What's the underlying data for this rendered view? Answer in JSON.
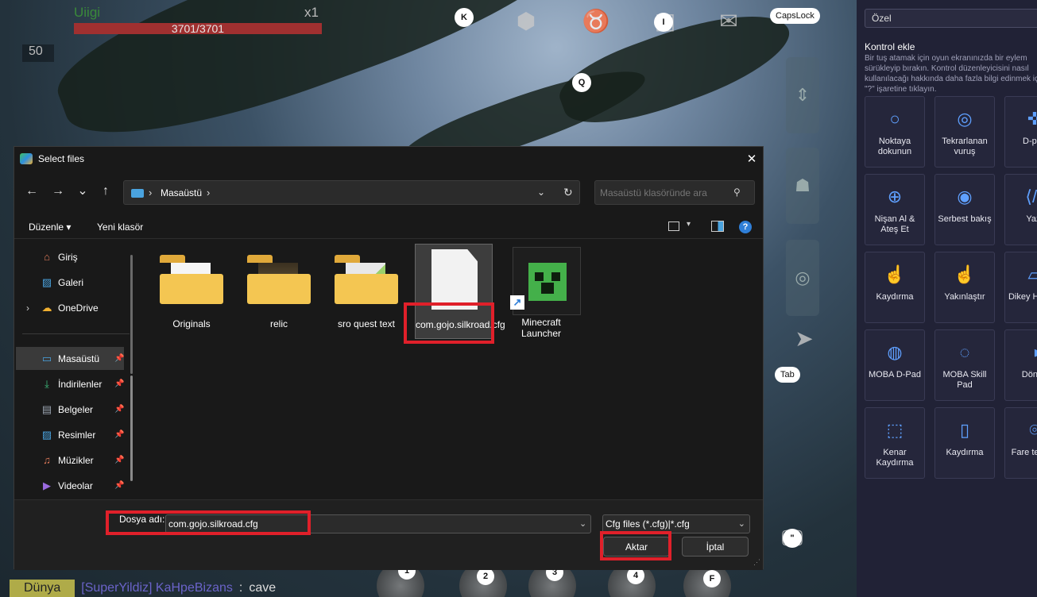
{
  "game": {
    "target_name": "Uiigi",
    "hp_text": "3701/3701",
    "hp_fraction": 1.0,
    "multiplier": "x1",
    "level": "50",
    "keys": {
      "k": "K",
      "i": "I",
      "caps": "CapsLock",
      "q": "Q",
      "tab": "Tab",
      "quote": "\"",
      "s1": "1",
      "s2": "2",
      "s3": "3",
      "s4": "4",
      "f": "F"
    },
    "chat": {
      "channel": "Dünya",
      "sender": "[SuperYildiz] KaHpeBizans",
      "sep": ":",
      "message": "cave"
    }
  },
  "panel": {
    "profile_select": "Özel",
    "title": "Kontrol ekle",
    "description": "Bir tuş atamak için oyun ekranınızda bir eylem sürükleyip bırakın. Kontrol düzenleyicisini nasıl kullanılacağı hakkında daha fazla bilgi edinmek için \"?\" işaretine tıklayın.",
    "controls": [
      {
        "label": "Noktaya dokunun",
        "icon": "tap-point-icon"
      },
      {
        "label": "Tekrarlanan vuruş",
        "icon": "repeated-tap-icon"
      },
      {
        "label": "D-pad",
        "icon": "dpad-icon"
      },
      {
        "label": "Nişan Al & Ateş Et",
        "icon": "aim-fire-icon"
      },
      {
        "label": "Serbest bakış",
        "icon": "free-look-icon"
      },
      {
        "label": "Yazı",
        "icon": "text-input-icon"
      },
      {
        "label": "Kaydırma",
        "icon": "swipe-icon"
      },
      {
        "label": "Yakınlaştır",
        "icon": "zoom-icon"
      },
      {
        "label": "Dikey Hareke",
        "icon": "tilt-icon"
      },
      {
        "label": "MOBA D-Pad",
        "icon": "moba-dpad-icon"
      },
      {
        "label": "MOBA Skill Pad",
        "icon": "moba-skill-icon"
      },
      {
        "label": "Döndü",
        "icon": "rotate-icon"
      },
      {
        "label": "Kenar Kaydırma",
        "icon": "edge-scroll-icon"
      },
      {
        "label": "Kaydırma",
        "icon": "scroll-icon"
      },
      {
        "label": "Fare tekerle",
        "icon": "mouse-wheel-icon"
      }
    ]
  },
  "dialog": {
    "title": "Select files",
    "close": "✕",
    "nav": {
      "back": "←",
      "forward": "→",
      "recent": "⌄",
      "up": "↑"
    },
    "address": {
      "separator": "›",
      "crumb": "Masaüstü",
      "refresh": "↻",
      "dropdown": "⌄"
    },
    "search_placeholder": "Masaüstü klasöründe ara",
    "toolbar": {
      "organize": "Düzenle ▾",
      "new_folder": "Yeni klasör",
      "view_dropdown": "▾",
      "help": "?"
    },
    "nav_items": [
      {
        "label": "Giriş",
        "icon": "home-icon",
        "color": "#e07a5a",
        "pinned": false
      },
      {
        "label": "Galeri",
        "icon": "gallery-icon",
        "color": "#4aa3df",
        "pinned": false
      },
      {
        "label": "OneDrive",
        "icon": "cloud-icon",
        "color": "#f0b030",
        "pinned": false,
        "expandable": true
      },
      {
        "label": "Masaüstü",
        "icon": "desktop-icon",
        "color": "#4aa3df",
        "pinned": true,
        "selected": true
      },
      {
        "label": "İndirilenler",
        "icon": "download-icon",
        "color": "#3fbf7f",
        "pinned": true
      },
      {
        "label": "Belgeler",
        "icon": "documents-icon",
        "color": "#9aa4b0",
        "pinned": true
      },
      {
        "label": "Resimler",
        "icon": "pictures-icon",
        "color": "#4aa3df",
        "pinned": true
      },
      {
        "label": "Müzikler",
        "icon": "music-icon",
        "color": "#e07a5a",
        "pinned": true
      },
      {
        "label": "Videolar",
        "icon": "videos-icon",
        "color": "#9a6adf",
        "pinned": true
      }
    ],
    "pin_glyph": "📌",
    "expand_glyph": "›",
    "files": [
      {
        "name": "Originals",
        "kind": "folder"
      },
      {
        "name": "relic",
        "kind": "folder"
      },
      {
        "name": "sro quest text",
        "kind": "folder"
      },
      {
        "name": "com.gojo.silkroad.cfg",
        "kind": "file",
        "selected": true
      },
      {
        "name": "Minecraft Launcher",
        "kind": "shortcut"
      }
    ],
    "file_name_label": "Dosya adı:",
    "file_name_value": "com.gojo.silkroad.cfg",
    "file_type": "Cfg files (*.cfg)|*.cfg",
    "open_button": "Aktar",
    "cancel_button": "İptal"
  },
  "colors": {
    "highlight": "#e0202a",
    "accent": "#2f7fd8",
    "panel_bg": "#212236"
  }
}
